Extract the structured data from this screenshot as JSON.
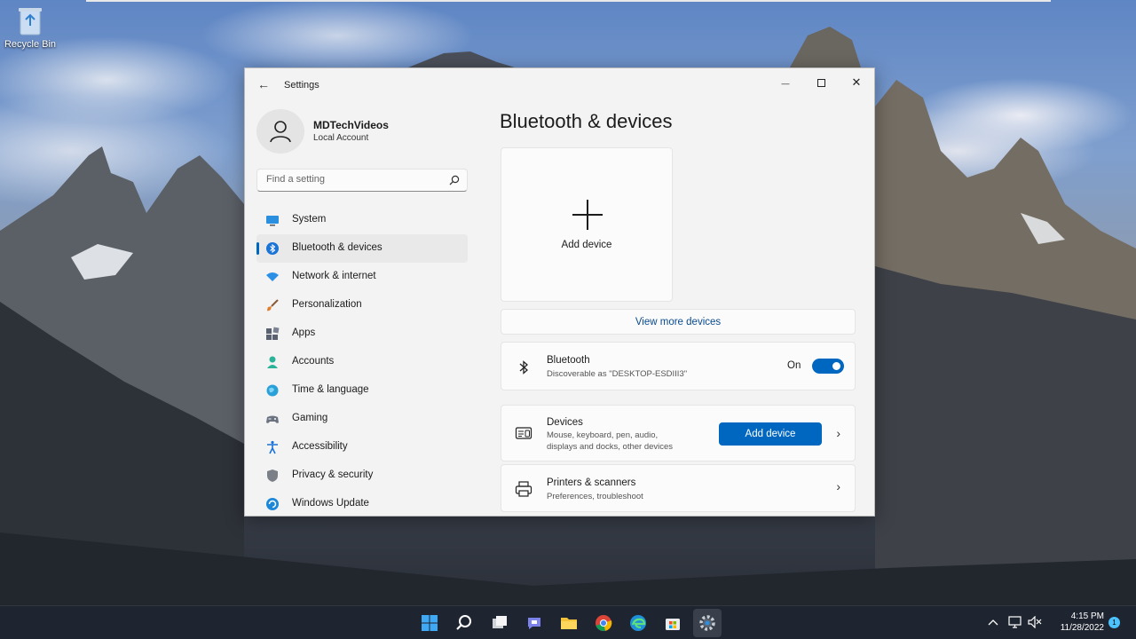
{
  "desktop": {
    "recycle_bin_label": "Recycle Bin"
  },
  "window": {
    "title": "Settings",
    "controls": {
      "minimize": "—",
      "close": "✕"
    }
  },
  "profile": {
    "name": "MDTechVideos",
    "account_type": "Local Account"
  },
  "search": {
    "placeholder": "Find a setting"
  },
  "sidebar": {
    "items": [
      {
        "label": "System",
        "icon": "system-icon"
      },
      {
        "label": "Bluetooth & devices",
        "icon": "bluetooth-icon",
        "active": true
      },
      {
        "label": "Network & internet",
        "icon": "wifi-icon"
      },
      {
        "label": "Personalization",
        "icon": "brush-icon"
      },
      {
        "label": "Apps",
        "icon": "apps-icon"
      },
      {
        "label": "Accounts",
        "icon": "accounts-icon"
      },
      {
        "label": "Time & language",
        "icon": "globe-icon"
      },
      {
        "label": "Gaming",
        "icon": "gamepad-icon"
      },
      {
        "label": "Accessibility",
        "icon": "accessibility-icon"
      },
      {
        "label": "Privacy & security",
        "icon": "shield-icon"
      },
      {
        "label": "Windows Update",
        "icon": "update-icon"
      }
    ]
  },
  "main": {
    "title": "Bluetooth & devices",
    "add_tile_label": "Add device",
    "view_more": "View more devices",
    "bluetooth": {
      "title": "Bluetooth",
      "subtitle": "Discoverable as \"DESKTOP-ESDIII3\"",
      "state": "On"
    },
    "devices": {
      "title": "Devices",
      "subtitle_1": "Mouse, keyboard, pen, audio,",
      "subtitle_2": "displays and docks, other devices",
      "button": "Add device"
    },
    "printers": {
      "title": "Printers & scanners",
      "subtitle": "Preferences, troubleshoot"
    }
  },
  "taskbar": {
    "time": "4:15 PM",
    "date": "11/28/2022",
    "notifications": "1"
  },
  "colors": {
    "accent": "#0067c0",
    "taskbar": "#1f2530"
  }
}
